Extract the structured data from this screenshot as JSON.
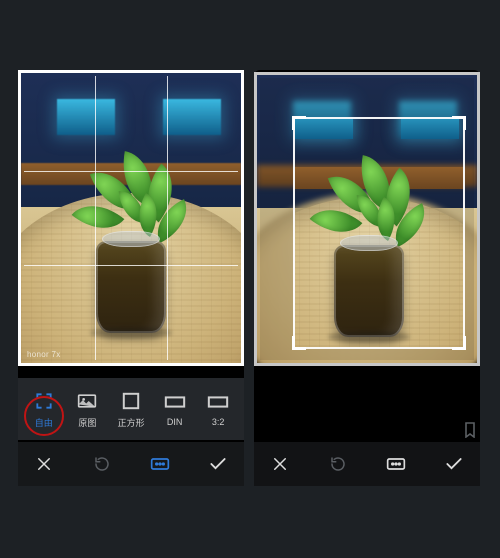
{
  "watermark": "honor 7x",
  "ratio_options": [
    {
      "key": "free",
      "label": "自由"
    },
    {
      "key": "original",
      "label": "原图"
    },
    {
      "key": "square",
      "label": "正方形"
    },
    {
      "key": "din",
      "label": "DIN"
    },
    {
      "key": "3_2",
      "label": "3:2"
    }
  ],
  "active_ratio": "free",
  "highlighted_ratio": "free",
  "colors": {
    "accent": "#2f7bd9",
    "highlight_ring": "#c01414",
    "background": "#1d2125"
  }
}
